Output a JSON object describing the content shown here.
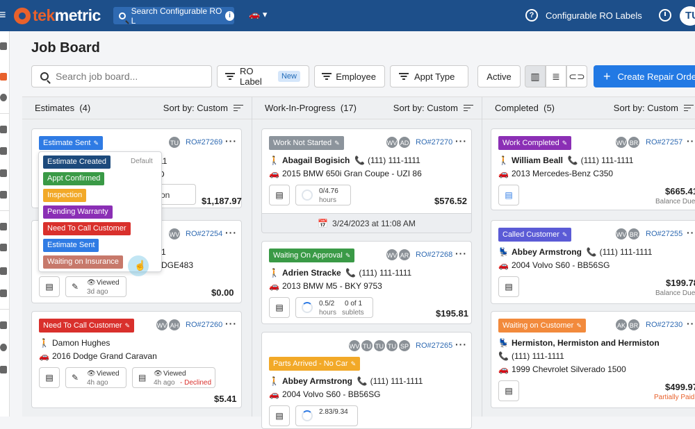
{
  "topbar": {
    "logo_prefix": "tek",
    "logo_suffix": "metric",
    "search_placeholder": "Search Configurable RO L",
    "info_icon": "i",
    "help_icon": "?",
    "label": "Configurable RO Labels",
    "avatar": "TU"
  },
  "page_title": "Job Board",
  "toolbar": {
    "search_placeholder": "Search job board...",
    "ro_label": "RO Label",
    "new_badge": "New",
    "employee": "Employee",
    "appt_type": "Appt Type",
    "active": "Active",
    "create": "Create Repair Order",
    "create_plus": "+"
  },
  "columns": [
    {
      "title": "Estimates",
      "count": "(4)",
      "sort": "Sort by: Custom"
    },
    {
      "title": "Work-In-Progress",
      "count": "(17)",
      "sort": "Sort by: Custom"
    },
    {
      "title": "Completed",
      "count": "(5)",
      "sort": "Sort by: Custom"
    }
  ],
  "dropdown": {
    "default_label": "Default",
    "options": [
      "Estimate Created",
      "Appt Confirmed",
      "Inspection",
      "Pending Warranty",
      "Need To Call Customer",
      "Estimate Sent",
      "Waiting on Insurance"
    ]
  },
  "cards": {
    "e1": {
      "status": "Estimate Sent",
      "avatar": "TU",
      "ro": "RO#27269",
      "frag1": "11",
      "frag2": "D",
      "frag3": "on",
      "price": "$1,187.97"
    },
    "e2": {
      "avatar": "WV",
      "ro": "RO#27254",
      "frag1": "1",
      "frag2": "DGE483",
      "viewed": "Viewed",
      "ago": "3d ago",
      "price": "$0.00"
    },
    "e3": {
      "status": "Need To Call Customer",
      "avatars": [
        "WV",
        "AH"
      ],
      "ro": "RO#27260",
      "name": "Damon Hughes",
      "vehicle": "2016 Dodge Grand Caravan",
      "viewed1": "Viewed",
      "ago1": "4h ago",
      "viewed2": "Viewed",
      "ago2": "4h ago",
      "declined": "- Declined",
      "price": "$5.41"
    },
    "w1": {
      "status": "Work Not Started",
      "avatars": [
        "WV",
        "AD"
      ],
      "ro": "RO#27270",
      "name": "Abagail Bogisich",
      "phone": "(111) 111-1111",
      "vehicle": "2015 BMW 650i Gran Coupe - UZI 86",
      "hours_val": "0/4.76",
      "hours_label": "hours",
      "price": "$576.52",
      "date": "3/24/2023 at 11:08 AM"
    },
    "w2": {
      "status": "Waiting On Approval",
      "avatars": [
        "WV",
        "AR"
      ],
      "ro": "RO#27268",
      "name": "Adrien Stracke",
      "phone": "(111) 111-1111",
      "vehicle": "2013 BMW M5 - BKY 9753",
      "hours_val": "0.5/2",
      "hours_label": "hours",
      "sublets_val": "0 of 1",
      "sublets_label": "sublets",
      "price": "$195.81"
    },
    "w3": {
      "status": "Parts Arrived - No Car",
      "avatars": [
        "WV",
        "TU",
        "TU",
        "TU",
        "SP"
      ],
      "ro": "RO#27265",
      "name": "Abbey Armstrong",
      "phone": "(111) 111-1111",
      "vehicle": "2004 Volvo S60 - BB56SG",
      "hours_val": "2.83/9.34"
    },
    "c1": {
      "status": "Work Completed",
      "avatars": [
        "WV",
        "BR"
      ],
      "ro": "RO#27257",
      "name": "William Beall",
      "phone": "(111) 111-1111",
      "vehicle": "2013 Mercedes-Benz C350",
      "price": "$665.41",
      "balance": "Balance Due"
    },
    "c2": {
      "status": "Called Customer",
      "avatars": [
        "WV",
        "BR"
      ],
      "ro": "RO#27255",
      "name": "Abbey Armstrong",
      "phone": "(111) 111-1111",
      "vehicle": "2004 Volvo S60 - BB56SG",
      "price": "$199.78",
      "balance": "Balance Due"
    },
    "c3": {
      "status": "Waiting on Customer",
      "avatars": [
        "AK",
        "BR"
      ],
      "ro": "RO#27230",
      "name": "Hermiston, Hermiston and Hermiston",
      "phone": "(111) 111-1111",
      "vehicle": "1999 Chevrolet Silverado 1500",
      "price": "$499.97",
      "balance": "Partially Paid"
    }
  },
  "colors": {
    "topbar": "#1d4f8a",
    "accent": "#2279e4",
    "estimate_sent": "#2f7be4",
    "need_to_call": "#d9302c",
    "work_not_started": "#8c949c",
    "waiting_approval": "#3a9a46",
    "parts_arrived": "#f2a928",
    "work_completed": "#8b2fb5",
    "called_customer": "#5b5bd6",
    "waiting_customer": "#f28a3c"
  }
}
